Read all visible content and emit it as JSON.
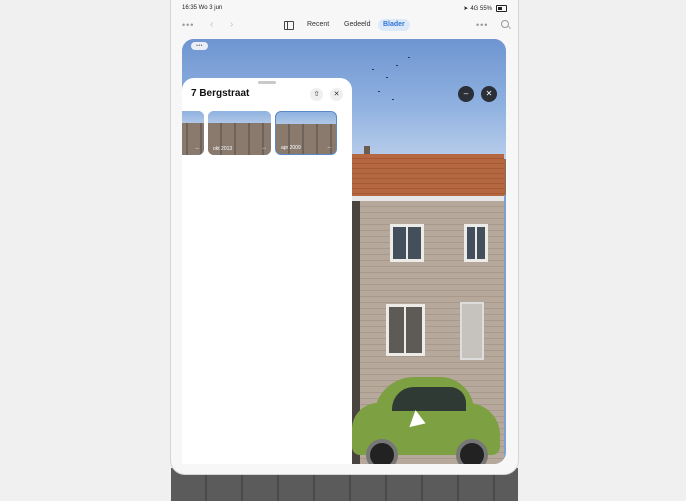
{
  "statusbar": {
    "time_date": "16:35 Wo 3 jun",
    "signal": "4G 55%"
  },
  "toolbar": {
    "more_left": "•••",
    "back": "‹",
    "forward": "›",
    "tabs": [
      "Recent",
      "Gedeeld",
      "Blader"
    ],
    "active_tab": "Blader",
    "more_right": "•••"
  },
  "map": {
    "top_pill": "•••"
  },
  "panel": {
    "title": "7 Bergstraat",
    "thumbnails": [
      {
        "label": ""
      },
      {
        "label": "okt 2013"
      },
      {
        "label": "apr 2009"
      }
    ]
  },
  "icons": {
    "share": "share-icon",
    "close": "close-icon",
    "collapse": "minus-icon",
    "search": "search-icon",
    "sidebar": "sidebar-icon"
  },
  "colors": {
    "accent": "#2f74d6",
    "panel_bg": "#ffffff",
    "map_button": "#2a2f38"
  }
}
